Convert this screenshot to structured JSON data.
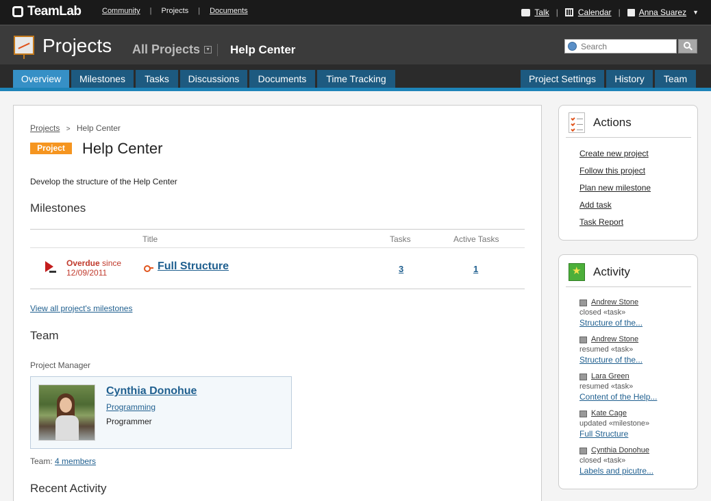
{
  "topbar": {
    "logo": "TeamLab",
    "nav": [
      "Community",
      "Projects",
      "Documents"
    ],
    "talk": "Talk",
    "calendar": "Calendar",
    "user": "Anna Suarez"
  },
  "header": {
    "title": "Projects",
    "all_projects": "All Projects",
    "current_project": "Help Center",
    "search_placeholder": "Search"
  },
  "tabs": {
    "left": [
      "Overview",
      "Milestones",
      "Tasks",
      "Discussions",
      "Documents",
      "Time Tracking"
    ],
    "right": [
      "Project Settings",
      "History",
      "Team"
    ],
    "active": "Overview"
  },
  "main": {
    "breadcrumb_link": "Projects",
    "breadcrumb_sep": ">",
    "breadcrumb_current": "Help Center",
    "badge": "Project",
    "project_name": "Help Center",
    "description": "Develop the structure of the Help Center",
    "milestones_heading": "Milestones",
    "milestone_columns": {
      "title": "Title",
      "tasks": "Tasks",
      "active": "Active Tasks"
    },
    "milestone": {
      "status": "Overdue",
      "since": "since",
      "date": "12/09/2011",
      "title": "Full Structure",
      "tasks": "3",
      "active_tasks": "1"
    },
    "view_all": "View all project's milestones",
    "team_heading": "Team",
    "pm_label": "Project Manager",
    "pm": {
      "name": "Cynthia Donohue",
      "department": "Programming",
      "role": "Programmer"
    },
    "team_label": "Team:",
    "team_members": "4 members",
    "recent_heading": "Recent Activity"
  },
  "actions": {
    "title": "Actions",
    "links": [
      "Create new project",
      "Follow this project",
      "Plan new milestone",
      "Add task",
      "Task Report"
    ]
  },
  "activity": {
    "title": "Activity",
    "items": [
      {
        "user": "Andrew Stone",
        "action": "closed «task»",
        "subject": "Structure of the..."
      },
      {
        "user": "Andrew Stone",
        "action": "resumed «task»",
        "subject": "Structure of the..."
      },
      {
        "user": "Lara Green",
        "action": "resumed «task»",
        "subject": "Content of the Help..."
      },
      {
        "user": "Kate Cage",
        "action": "updated «milestone»",
        "subject": "Full Structure"
      },
      {
        "user": "Cynthia Donohue",
        "action": "closed «task»",
        "subject": "Labels and picutre..."
      }
    ]
  },
  "colors": {
    "accent": "#3690c6",
    "tab": "#1d5a80",
    "badge": "#f59520",
    "overdue": "#c0392b",
    "link": "#1f5f8f"
  }
}
